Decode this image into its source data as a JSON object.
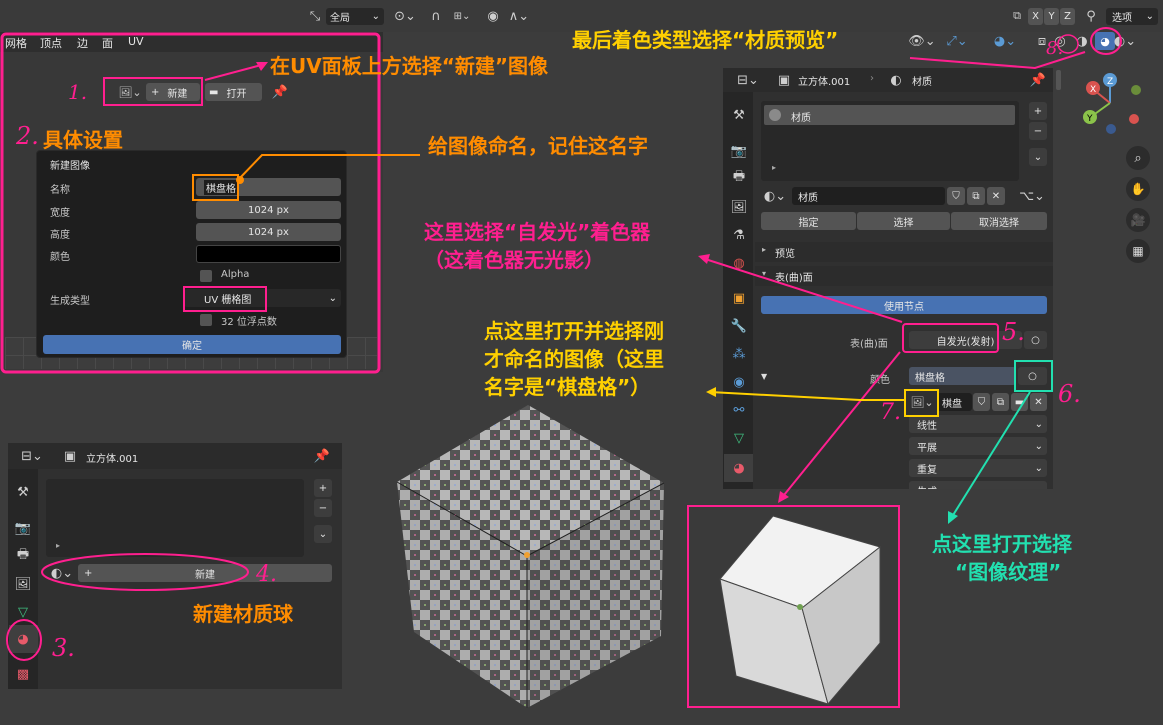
{
  "top_header": {
    "global_label": "全局",
    "axes": [
      "X",
      "Y",
      "Z"
    ],
    "options_label": "选项"
  },
  "uv_menu": [
    "网格",
    "顶点",
    "边",
    "面",
    "UV"
  ],
  "uv_header": {
    "new_label": "新建",
    "open_label": "打开"
  },
  "new_image": {
    "title": "新建图像",
    "name_label": "名称",
    "name_value": "棋盘格",
    "width_label": "宽度",
    "width_value": "1024 px",
    "height_label": "高度",
    "height_value": "1024 px",
    "color_label": "颜色",
    "alpha_label": "Alpha",
    "gen_type_label": "生成类型",
    "gen_type_value": "UV 栅格图",
    "float_label": "32 位浮点数",
    "ok_label": "确定"
  },
  "props_right": {
    "object_name": "立方体.001",
    "material_tab": "材质",
    "slot_item": "材质",
    "material_name": "材质",
    "assign": "指定",
    "select": "选择",
    "deselect": "取消选择",
    "preview_label": "预览",
    "surface_label": "表(曲)面",
    "use_nodes": "使用节点",
    "surface_field_label": "表(曲)面",
    "surface_shader": "自发光(发射)",
    "color_label": "颜色",
    "color_value": "棋盘格",
    "image_name": "棋盘",
    "interp": "线性",
    "projection": "平展",
    "extension": "重复",
    "source_cut": "生成"
  },
  "props_left": {
    "object_name": "立方体.001",
    "new_material": "新建"
  },
  "annotations": {
    "a1": "在UV面板上方选择“新建”图像",
    "a2": "具体设置",
    "a_name": "给图像命名，记住这名字",
    "a_last": "最后着色类型选择“材质预览”",
    "a_emit1": "这里选择“自发光”着色器",
    "a_emit2": "（这着色器无光影）",
    "a_open1": "点这里打开并选择刚",
    "a_open2": "才命名的图像（这里",
    "a_open3": "名字是“棋盘格”）",
    "a_tex1": "点这里打开选择",
    "a_tex2": "“图像纹理”",
    "a_newmat": "新建材质球",
    "n1": "1.",
    "n2": "2.",
    "n3": "3.",
    "n4": "4.",
    "n5": "5.",
    "n6": "6.",
    "n7": "7.",
    "n8": "8."
  },
  "colors": {
    "orange": "#ff8c00",
    "pink": "#ff1f8f",
    "yellow": "#ffd000",
    "cyan": "#22e0b0",
    "blender_blue": "#4772b3"
  }
}
